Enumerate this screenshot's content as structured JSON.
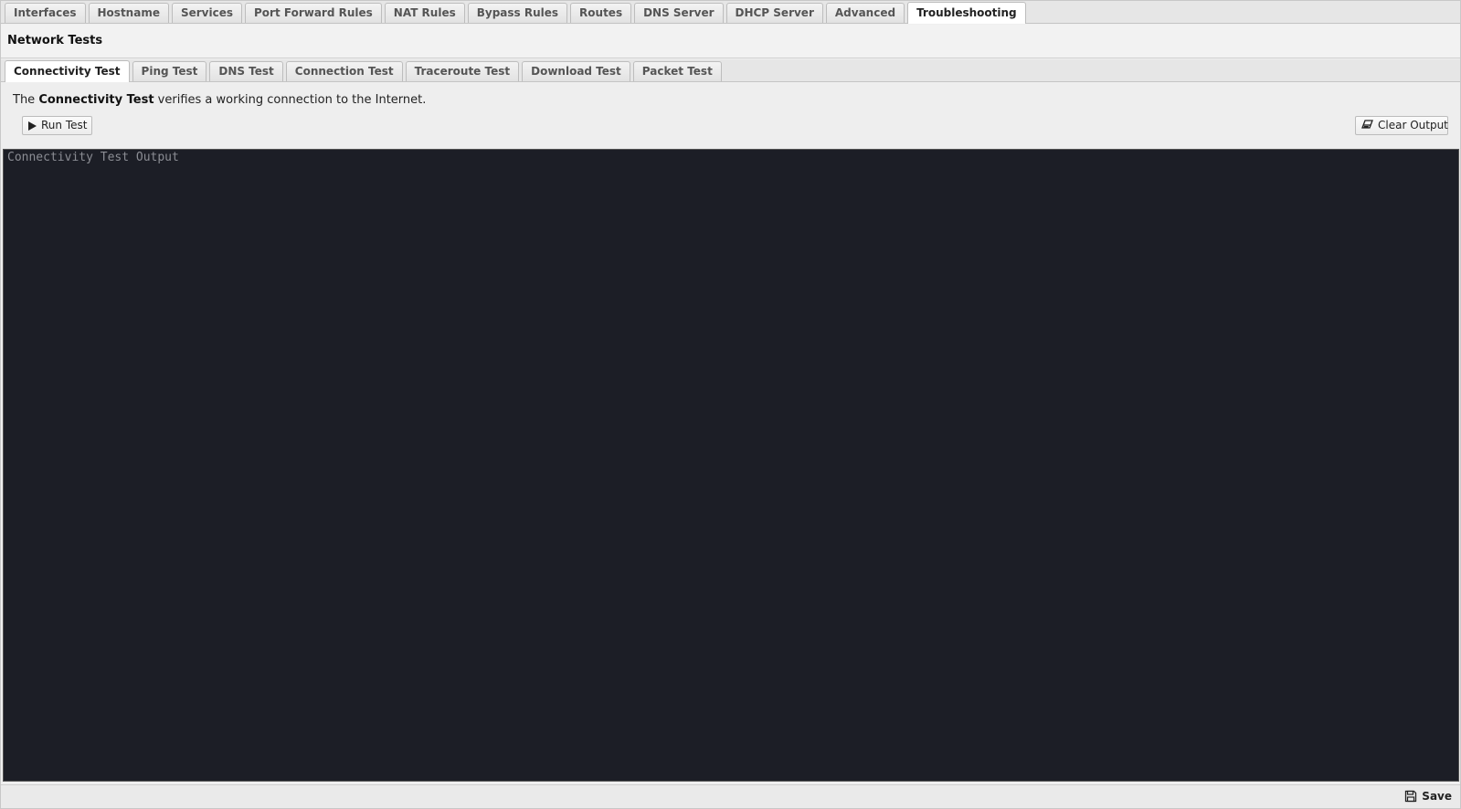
{
  "top_tabs": [
    {
      "label": "Interfaces",
      "active": false
    },
    {
      "label": "Hostname",
      "active": false
    },
    {
      "label": "Services",
      "active": false
    },
    {
      "label": "Port Forward Rules",
      "active": false
    },
    {
      "label": "NAT Rules",
      "active": false
    },
    {
      "label": "Bypass Rules",
      "active": false
    },
    {
      "label": "Routes",
      "active": false
    },
    {
      "label": "DNS Server",
      "active": false
    },
    {
      "label": "DHCP Server",
      "active": false
    },
    {
      "label": "Advanced",
      "active": false
    },
    {
      "label": "Troubleshooting",
      "active": true
    }
  ],
  "section": {
    "title": "Network Tests"
  },
  "sub_tabs": [
    {
      "label": "Connectivity Test",
      "active": true
    },
    {
      "label": "Ping Test",
      "active": false
    },
    {
      "label": "DNS Test",
      "active": false
    },
    {
      "label": "Connection Test",
      "active": false
    },
    {
      "label": "Traceroute Test",
      "active": false
    },
    {
      "label": "Download Test",
      "active": false
    },
    {
      "label": "Packet Test",
      "active": false
    }
  ],
  "content": {
    "description_prefix": "The ",
    "description_bold": "Connectivity Test",
    "description_suffix": " verifies a working connection to the Internet.",
    "run_button": {
      "label": "Run Test",
      "icon": "play-icon"
    },
    "clear_button": {
      "label": "Clear Output",
      "icon": "eraser-icon"
    },
    "terminal_placeholder": "Connectivity Test Output"
  },
  "footer": {
    "save_label": "Save",
    "save_icon": "floppy-disk-icon"
  },
  "colors": {
    "terminal_bg": "#1c1e26",
    "terminal_placeholder": "#8b8d94",
    "panel_bg": "#eeeeee"
  }
}
